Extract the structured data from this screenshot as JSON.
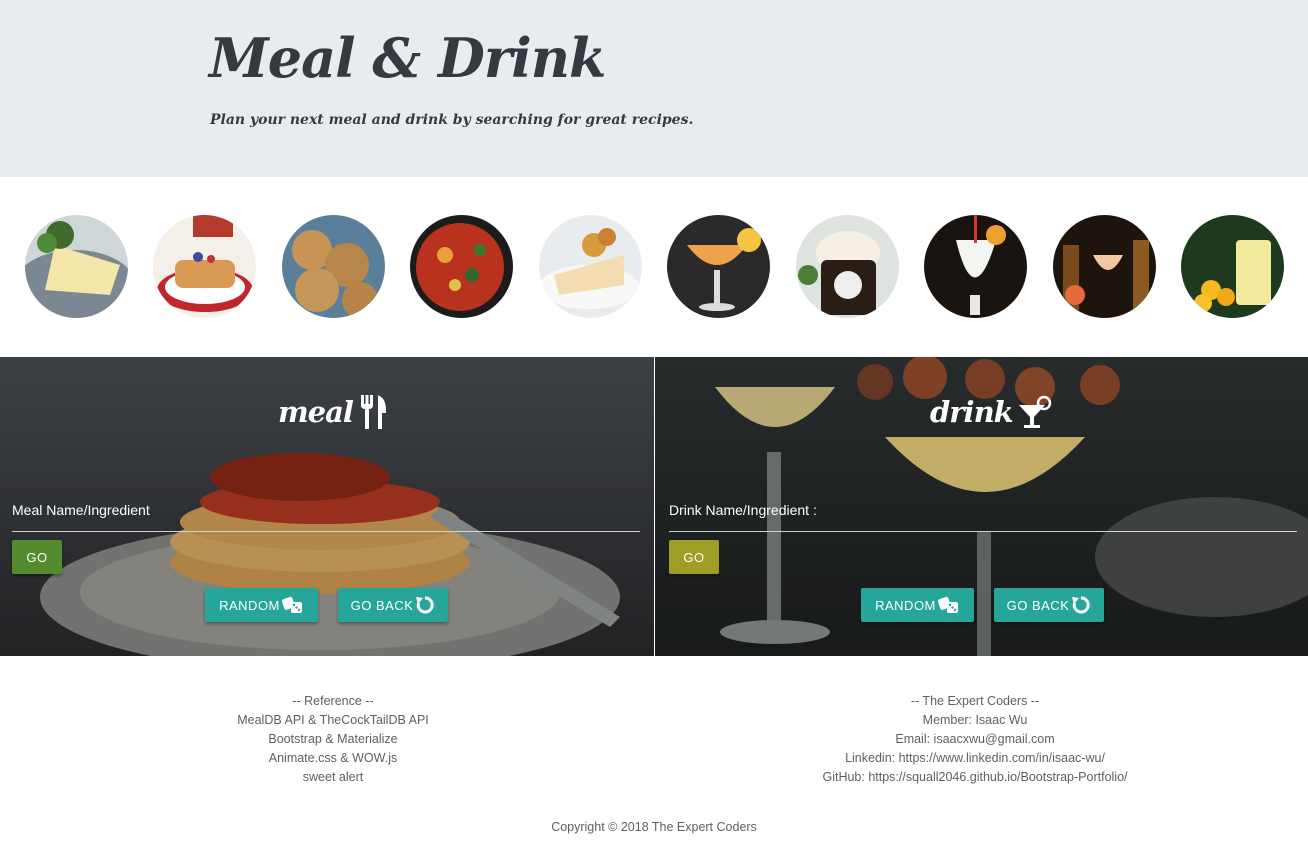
{
  "header": {
    "title": "Meal & Drink",
    "subtitle": "Plan your next meal and drink by searching for great recipes."
  },
  "gallery": [
    {
      "icon": "omelette-photo"
    },
    {
      "icon": "pancakes-berries-photo"
    },
    {
      "icon": "cookies-photo"
    },
    {
      "icon": "stir-fry-photo"
    },
    {
      "icon": "cake-slice-photo"
    },
    {
      "icon": "orange-cocktail-photo"
    },
    {
      "icon": "root-beer-float-photo"
    },
    {
      "icon": "pina-colada-photo"
    },
    {
      "icon": "bar-bottles-photo"
    },
    {
      "icon": "lemonade-photo"
    }
  ],
  "meal": {
    "title": "meal",
    "icon": "utensils-icon",
    "field_label": "Meal Name/Ingredient",
    "input_value": "",
    "go_label": "GO",
    "random_label": "RANDOM",
    "random_icon": "dice-icon",
    "goback_label": "GO BACK",
    "goback_icon": "undo-icon"
  },
  "drink": {
    "title": "drink",
    "icon": "cocktail-icon",
    "field_label": "Drink Name/Ingredient :",
    "input_value": "",
    "go_label": "GO",
    "random_label": "RANDOM",
    "random_icon": "dice-icon",
    "goback_label": "GO BACK",
    "goback_icon": "undo-icon"
  },
  "footer": {
    "reference": [
      "-- Reference --",
      "MealDB API & TheCockTailDB API",
      "Bootstrap & Materialize",
      "Animate.css & WOW.js",
      "sweet alert"
    ],
    "team": [
      "-- The Expert Coders --",
      "Member: Isaac Wu",
      "Email: isaacxwu@gmail.com",
      "Linkedin: https://www.linkedin.com/in/isaac-wu/",
      "GitHub: https://squall2046.github.io/Bootstrap-Portfolio/"
    ],
    "copyright": "Copyright © 2018 The Expert Coders"
  },
  "colors": {
    "header_bg": "#e9ecef",
    "meal_go": "#558b2f",
    "drink_go": "#9e9d24",
    "teal_button": "#26a69a"
  }
}
